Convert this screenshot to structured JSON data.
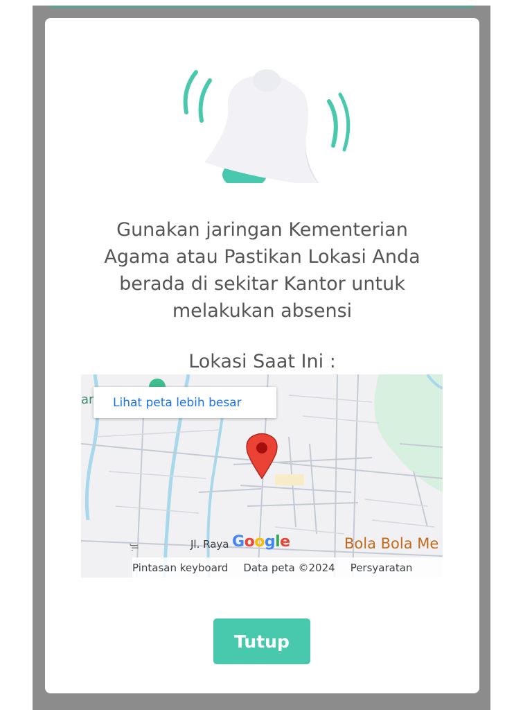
{
  "dialog": {
    "message": "Gunakan jaringan Kementerian\nAgama atau Pastikan Lokasi Anda\nberada di sekitar Kantor untuk\nmelakukan absensi",
    "location_title": "Lokasi Saat Ini :",
    "close_label": "Tutup",
    "accent_color": "#48c8ad"
  },
  "map": {
    "view_larger_label": "Lihat peta lebih besar",
    "street_label": "Jl. Raya",
    "place_label": "Bola Bola Me",
    "footer": {
      "keyboard_shortcuts": "Pintasan keyboard",
      "map_data": "Data peta ©2024",
      "terms": "Persyaratan"
    },
    "logo": "Google",
    "pin_color": "#ea4335",
    "icons": [
      "bell-icon",
      "map-pin-icon"
    ]
  }
}
